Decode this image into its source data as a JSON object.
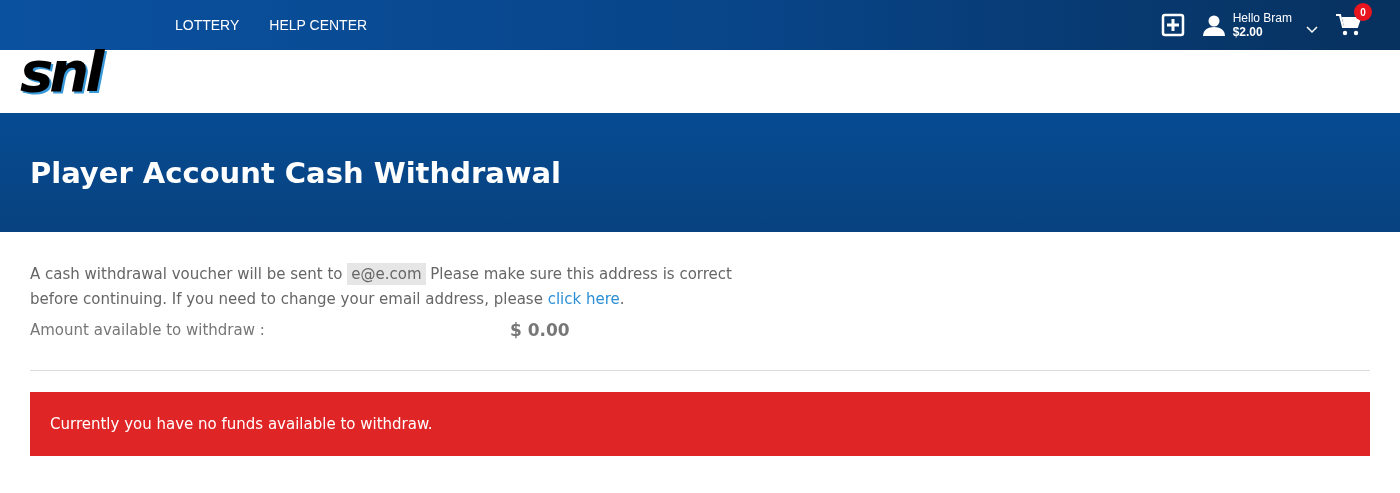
{
  "logo": {
    "text": "snl"
  },
  "nav": [
    {
      "label": "LOTTERY"
    },
    {
      "label": "HELP CENTER"
    }
  ],
  "account": {
    "greeting": "Hello Bram",
    "balance": "$2.00",
    "cart_count": "0"
  },
  "banner": {
    "title": "Player Account Cash Withdrawal"
  },
  "notice": {
    "before": "A cash withdrawal voucher will be sent to ",
    "email": "e@e.com",
    "after": " Please make sure this address is correct before continuing. If you need to change your email address, please ",
    "link": "click here",
    "end": "."
  },
  "amount": {
    "label": "Amount available to withdraw :",
    "value": "$ 0.00"
  },
  "alert": {
    "message": "Currently you have no funds available to withdraw."
  }
}
